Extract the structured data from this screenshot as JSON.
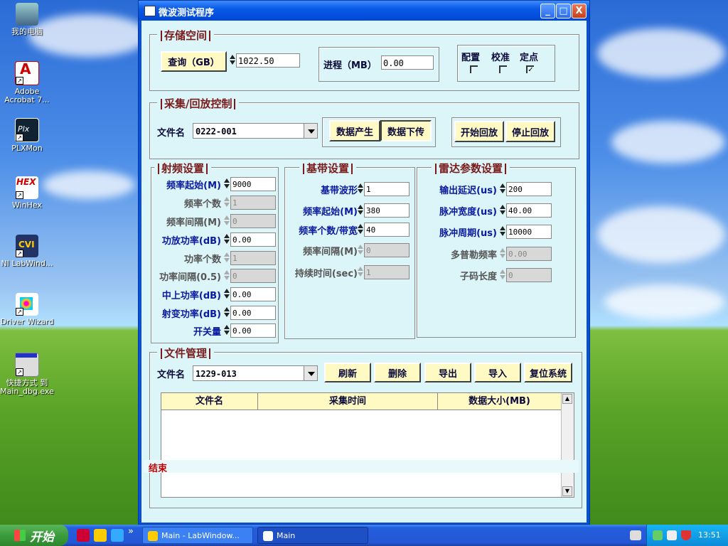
{
  "desktop": {
    "icons": [
      {
        "label": "我的电脑"
      },
      {
        "label": "Adobe Acrobat 7..."
      },
      {
        "label": "PLXMon"
      },
      {
        "label": "WinHex"
      },
      {
        "label": "NI LabWind..."
      },
      {
        "label": "Driver Wizard"
      },
      {
        "label": "快捷方式 到 Main_dbg.exe"
      }
    ]
  },
  "window": {
    "title": "微波测试程序",
    "minimize": "_",
    "maximize": "□",
    "close": "X"
  },
  "storage": {
    "title": "存储空间",
    "query_label": "查询（GB）",
    "query_value": "1022.50",
    "progress_label": "进程（MB）",
    "progress_value": "0.00",
    "checks": [
      {
        "label": "配置",
        "checked": false
      },
      {
        "label": "校准",
        "checked": false
      },
      {
        "label": "定点",
        "checked": true
      }
    ]
  },
  "acquire": {
    "title": "采集/回放控制",
    "file_label": "文件名",
    "file_value": "0222-001",
    "gen_btn": "数据产生",
    "download_btn": "数据下传",
    "start_play": "开始回放",
    "stop_play": "停止回放"
  },
  "rf": {
    "title": "射频设置",
    "rows": [
      {
        "label": "频率起始(M)",
        "value": "9000",
        "enabled": true
      },
      {
        "label": "频率个数",
        "value": "1",
        "enabled": false
      },
      {
        "label": "频率间隔(M)",
        "value": "0",
        "enabled": false
      },
      {
        "label": "功放功率(dB)",
        "value": "0.00",
        "enabled": true
      },
      {
        "label": "功率个数",
        "value": "1",
        "enabled": false
      },
      {
        "label": "功率间隔(0.5)",
        "value": "0",
        "enabled": false
      },
      {
        "label": "中上功率(dB)",
        "value": "0.00",
        "enabled": true
      },
      {
        "label": "射变功率(dB)",
        "value": "0.00",
        "enabled": true
      },
      {
        "label": "开关量",
        "value": "0.00",
        "enabled": true
      }
    ]
  },
  "baseband": {
    "title": "基带设置",
    "rows": [
      {
        "label": "基带波形",
        "value": "1",
        "enabled": true
      },
      {
        "label": "频率起始(M)",
        "value": "380",
        "enabled": true
      },
      {
        "label": "频率个数/带宽",
        "value": "40",
        "enabled": true
      },
      {
        "label": "频率间隔(M)",
        "value": "0",
        "enabled": false
      },
      {
        "label": "持续时间(sec)",
        "value": "1",
        "enabled": false
      }
    ]
  },
  "radar": {
    "title": "雷达参数设置",
    "rows": [
      {
        "label": "输出延迟(us)",
        "value": "200",
        "enabled": true
      },
      {
        "label": "脉冲宽度(us)",
        "value": "40.00",
        "enabled": true
      },
      {
        "label": "脉冲周期(us)",
        "value": "10000",
        "enabled": true
      },
      {
        "label": "多普勒频率",
        "value": "0.00",
        "enabled": false
      },
      {
        "label": "子码长度",
        "value": "0",
        "enabled": false
      }
    ]
  },
  "files": {
    "title": "文件管理",
    "file_label": "文件名",
    "file_value": "1229-013",
    "buttons": [
      "刷新",
      "删除",
      "导出",
      "导入",
      "复位系统"
    ],
    "columns": [
      "文件名",
      "采集时间",
      "数据大小(MB)"
    ],
    "status": "结束"
  },
  "taskbar": {
    "start": "开始",
    "items": [
      "Main - LabWindow...",
      "Main"
    ],
    "clock": "13:51",
    "chevron": "»"
  }
}
